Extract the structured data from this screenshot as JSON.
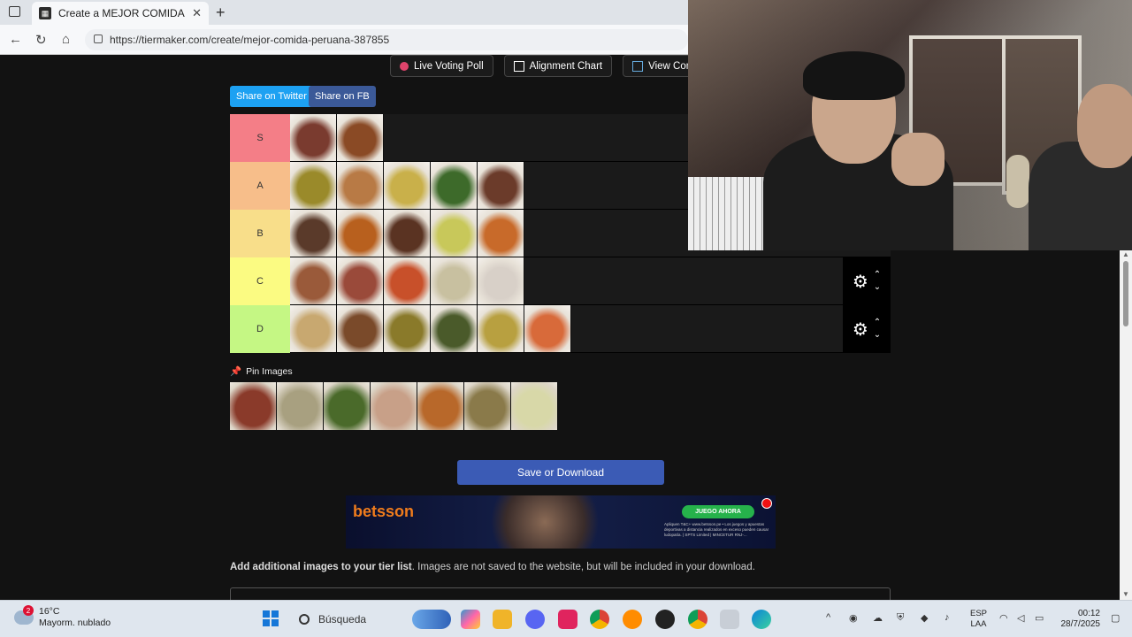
{
  "browser": {
    "tab_title": "Create a MEJOR COMIDA PERUAN",
    "url": "https://tiermaker.com/create/mejor-comida-peruana-387855"
  },
  "top_buttons": [
    {
      "label": "Live Voting Poll"
    },
    {
      "label": "Alignment Chart"
    },
    {
      "label": "View Commun"
    }
  ],
  "share": {
    "twitter": "Share on Twitter",
    "facebook": "Share on FB"
  },
  "tiers": [
    {
      "label": "S",
      "color": "#f47e87",
      "items": [
        "#7a3b2f",
        "#8a4a25"
      ]
    },
    {
      "label": "A",
      "color": "#f7be8a",
      "items": [
        "#9a8a2a",
        "#b87a45",
        "#c9b04a",
        "#3d6a2a",
        "#6b3b2a"
      ]
    },
    {
      "label": "B",
      "color": "#f8de8a",
      "items": [
        "#5a3a2a",
        "#b8601e",
        "#5a3322",
        "#c8c85a",
        "#c86a2a"
      ]
    },
    {
      "label": "C",
      "color": "#fbfb82",
      "items": [
        "#9a5a3a",
        "#9a4a3a",
        "#c8502a",
        "#c8c0a0",
        "#d8d0c8"
      ]
    },
    {
      "label": "D",
      "color": "#c5f784",
      "items": [
        "#c8a870",
        "#7a4a2a",
        "#8a7a2a",
        "#4a5a2a",
        "#b8a040",
        "#d86a3a"
      ]
    }
  ],
  "pin": {
    "label": "Pin Images",
    "items": [
      "#8a3a2a",
      "#a8a080",
      "#4a6a2a",
      "#c8a088",
      "#b8682a",
      "#8a7a4a",
      "#d8d8a8"
    ]
  },
  "save_button": "Save or Download",
  "ad": {
    "brand": "betsson",
    "cta": "JUEGO AHORA",
    "fine_print": "Apliquen T&C+ www.betsson.pe • Los juegos y apuestas deportivas a distancia realizados en exceso pueden causar ludopatía. | SPTS Limited | MINCETUR RNJ-..."
  },
  "add_images": {
    "bold": "Add additional images to your tier list",
    "rest": ". Images are not saved to the website, but will be included in your download."
  },
  "taskbar": {
    "temperature": "16°C",
    "weather": "Mayorm. nublado",
    "notification_count": "2",
    "search": "Búsqueda",
    "lang1": "ESP",
    "lang2": "LAA",
    "time": "00:12",
    "date": "28/7/2025"
  }
}
